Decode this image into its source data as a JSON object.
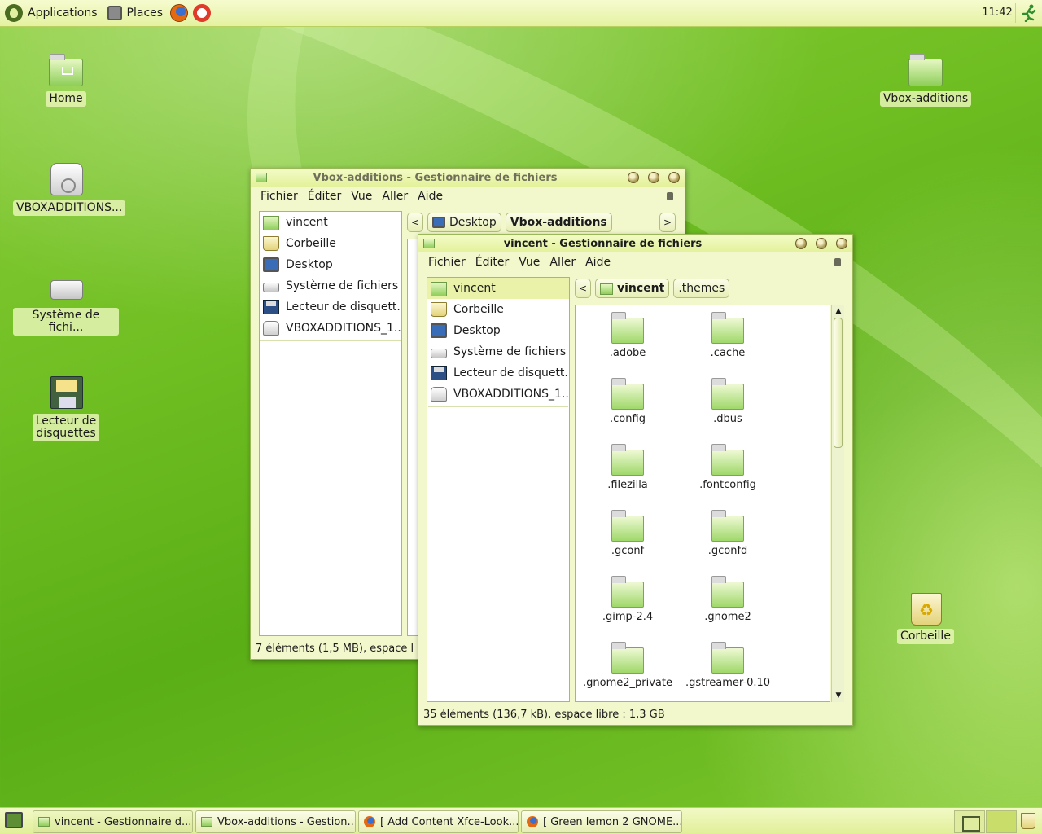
{
  "top_panel": {
    "applications_label": "Applications",
    "places_label": "Places",
    "clock": "11:42"
  },
  "desktop_icons": {
    "home": "Home",
    "vboxadditions_cd": "VBOXADDITIONS...",
    "system": "Système de fichi...",
    "floppy_line1": "Lecteur de",
    "floppy_line2": "disquettes",
    "vbox_folder": "Vbox-additions",
    "trash": "Corbeille"
  },
  "window_back": {
    "title": "Vbox-additions - Gestionnaire de fichiers",
    "menu": [
      "Fichier",
      "Éditer",
      "Vue",
      "Aller",
      "Aide"
    ],
    "sidebar": [
      "vincent",
      "Corbeille",
      "Desktop",
      "Système de fichiers",
      "Lecteur de disquett...",
      "VBOXADDITIONS_1...."
    ],
    "path": [
      "Desktop",
      "Vbox-additions"
    ],
    "status": "7 éléments (1,5 MB), espace libre : 1,3 GB"
  },
  "window_front": {
    "title": "vincent - Gestionnaire de fichiers",
    "menu": [
      "Fichier",
      "Éditer",
      "Vue",
      "Aller",
      "Aide"
    ],
    "sidebar": [
      "vincent",
      "Corbeille",
      "Desktop",
      "Système de fichiers",
      "Lecteur de disquett...",
      "VBOXADDITIONS_1...."
    ],
    "path": [
      "vincent",
      ".themes"
    ],
    "files": [
      ".adobe",
      ".cache",
      ".config",
      ".dbus",
      ".filezilla",
      ".fontconfig",
      ".gconf",
      ".gconfd",
      ".gimp-2.4",
      ".gnome2",
      ".gnome2_private",
      ".gstreamer-0.10"
    ],
    "status": "35 éléments (136,7 kB), espace libre : 1,3 GB"
  },
  "taskbar": [
    "vincent - Gestionnaire d...",
    "Vbox-additions - Gestion...",
    "[ Add Content Xfce-Look....",
    "[ Green lemon 2 GNOME..."
  ],
  "colors": {
    "panel": "#e8f4a8",
    "desktop": "#6fbe22",
    "selection": "#e9f2a8"
  }
}
